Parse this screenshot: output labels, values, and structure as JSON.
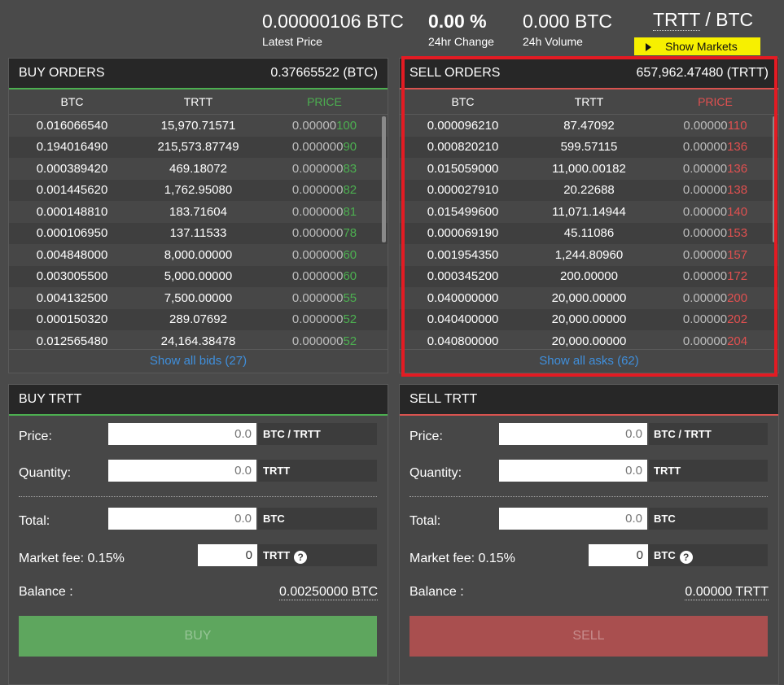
{
  "header": {
    "latest_price": {
      "value": "0.00000106 BTC",
      "label": "Latest Price"
    },
    "change_24h": {
      "value": "0.00 %",
      "label": "24hr Change"
    },
    "volume_24h": {
      "value": "0.000 BTC",
      "label": "24h Volume"
    },
    "pair": {
      "base": "TRTT",
      "sep": " / ",
      "quote": "BTC"
    },
    "show_markets_label": "Show Markets"
  },
  "buy_orders": {
    "title": "BUY ORDERS",
    "total": "0.37665522 (BTC)",
    "columns": [
      "BTC",
      "TRTT",
      "PRICE"
    ],
    "rows": [
      {
        "btc": "0.016066540",
        "trtt": "15,970.71571",
        "price_prefix": "0.00000",
        "price_suffix": "100"
      },
      {
        "btc": "0.194016490",
        "trtt": "215,573.87749",
        "price_prefix": "0.000000",
        "price_suffix": "90"
      },
      {
        "btc": "0.000389420",
        "trtt": "469.18072",
        "price_prefix": "0.000000",
        "price_suffix": "83"
      },
      {
        "btc": "0.001445620",
        "trtt": "1,762.95080",
        "price_prefix": "0.000000",
        "price_suffix": "82"
      },
      {
        "btc": "0.000148810",
        "trtt": "183.71604",
        "price_prefix": "0.000000",
        "price_suffix": "81"
      },
      {
        "btc": "0.000106950",
        "trtt": "137.11533",
        "price_prefix": "0.000000",
        "price_suffix": "78"
      },
      {
        "btc": "0.004848000",
        "trtt": "8,000.00000",
        "price_prefix": "0.000000",
        "price_suffix": "60"
      },
      {
        "btc": "0.003005500",
        "trtt": "5,000.00000",
        "price_prefix": "0.000000",
        "price_suffix": "60"
      },
      {
        "btc": "0.004132500",
        "trtt": "7,500.00000",
        "price_prefix": "0.000000",
        "price_suffix": "55"
      },
      {
        "btc": "0.000150320",
        "trtt": "289.07692",
        "price_prefix": "0.000000",
        "price_suffix": "52"
      },
      {
        "btc": "0.012565480",
        "trtt": "24,164.38478",
        "price_prefix": "0.000000",
        "price_suffix": "52"
      }
    ],
    "show_all": "Show all bids (27)"
  },
  "sell_orders": {
    "title": "SELL ORDERS",
    "total": "657,962.47480 (TRTT)",
    "columns": [
      "BTC",
      "TRTT",
      "PRICE"
    ],
    "rows": [
      {
        "btc": "0.000096210",
        "trtt": "87.47092",
        "price_prefix": "0.00000",
        "price_suffix": "110"
      },
      {
        "btc": "0.000820210",
        "trtt": "599.57115",
        "price_prefix": "0.00000",
        "price_suffix": "136"
      },
      {
        "btc": "0.015059000",
        "trtt": "11,000.00182",
        "price_prefix": "0.00000",
        "price_suffix": "136"
      },
      {
        "btc": "0.000027910",
        "trtt": "20.22688",
        "price_prefix": "0.00000",
        "price_suffix": "138"
      },
      {
        "btc": "0.015499600",
        "trtt": "11,071.14944",
        "price_prefix": "0.00000",
        "price_suffix": "140"
      },
      {
        "btc": "0.000069190",
        "trtt": "45.11086",
        "price_prefix": "0.00000",
        "price_suffix": "153"
      },
      {
        "btc": "0.001954350",
        "trtt": "1,244.80960",
        "price_prefix": "0.00000",
        "price_suffix": "157"
      },
      {
        "btc": "0.000345200",
        "trtt": "200.00000",
        "price_prefix": "0.00000",
        "price_suffix": "172"
      },
      {
        "btc": "0.040000000",
        "trtt": "20,000.00000",
        "price_prefix": "0.00000",
        "price_suffix": "200"
      },
      {
        "btc": "0.040400000",
        "trtt": "20,000.00000",
        "price_prefix": "0.00000",
        "price_suffix": "202"
      },
      {
        "btc": "0.040800000",
        "trtt": "20,000.00000",
        "price_prefix": "0.00000",
        "price_suffix": "204"
      }
    ],
    "show_all": "Show all asks (62)"
  },
  "buy_form": {
    "title": "BUY TRTT",
    "price_label": "Price:",
    "price_placeholder": "0.0",
    "price_unit": "BTC / TRTT",
    "quantity_label": "Quantity:",
    "quantity_placeholder": "0.0",
    "quantity_unit": "TRTT",
    "total_label": "Total:",
    "total_placeholder": "0.0",
    "total_unit": "BTC",
    "fee_label": "Market fee: 0.15%",
    "fee_value": "0",
    "fee_unit": "TRTT",
    "balance_label": "Balance :",
    "balance_value": "0.00250000 BTC",
    "button": "BUY"
  },
  "sell_form": {
    "title": "SELL TRTT",
    "price_label": "Price:",
    "price_placeholder": "0.0",
    "price_unit": "BTC / TRTT",
    "quantity_label": "Quantity:",
    "quantity_placeholder": "0.0",
    "quantity_unit": "TRTT",
    "total_label": "Total:",
    "total_placeholder": "0.0",
    "total_unit": "BTC",
    "fee_label": "Market fee: 0.15%",
    "fee_value": "0",
    "fee_unit": "BTC",
    "balance_label": "Balance :",
    "balance_value": "0.00000 TRTT",
    "button": "SELL"
  },
  "colors": {
    "buy_green": "#4caf50",
    "sell_red": "#e05050",
    "link_blue": "#3f8fdc",
    "markets_yellow": "#f7f000",
    "highlight_red": "#e31b23"
  }
}
